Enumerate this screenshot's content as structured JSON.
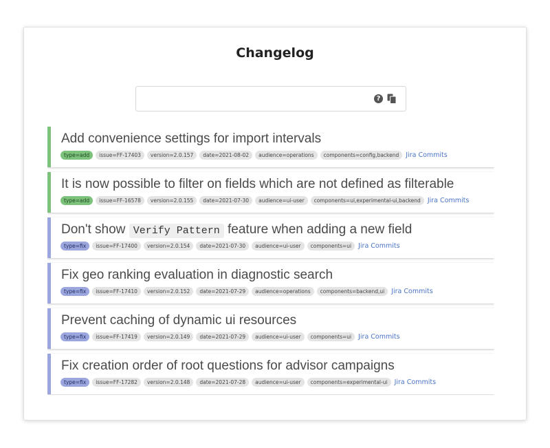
{
  "header": {
    "title": "Changelog"
  },
  "search": {
    "value": "",
    "placeholder": "",
    "help_icon": "question-circle-icon",
    "help_glyph": "?",
    "copy_icon": "copy-icon"
  },
  "colors": {
    "add": "#7cc17c",
    "fix": "#9aa6dd",
    "link": "#4a73c4"
  },
  "entries": [
    {
      "kind": "add",
      "title_pre": "Add convenience settings for import intervals",
      "title_code": "",
      "title_post": "",
      "tags": [
        "type=add",
        "issue=FF-17403",
        "version=2.0.157",
        "date=2021-08-02",
        "audience=operations",
        "components=config,backend"
      ],
      "link": "Jira Commits"
    },
    {
      "kind": "add",
      "title_pre": "It is now possible to filter on fields which are not defined as filterable",
      "title_code": "",
      "title_post": "",
      "tags": [
        "type=add",
        "issue=FF-16578",
        "version=2.0.155",
        "date=2021-07-30",
        "audience=ui-user",
        "components=ui,experimental-ui,backend"
      ],
      "link": "Jira Commits"
    },
    {
      "kind": "fix",
      "title_pre": "Don't show ",
      "title_code": "Verify Pattern",
      "title_post": " feature when adding a new field",
      "tags": [
        "type=fix",
        "issue=FF-17400",
        "version=2.0.154",
        "date=2021-07-30",
        "audience=ui-user",
        "components=ui"
      ],
      "link": "Jira Commits"
    },
    {
      "kind": "fix",
      "title_pre": "Fix geo ranking evaluation in diagnostic search",
      "title_code": "",
      "title_post": "",
      "tags": [
        "type=fix",
        "issue=FF-17410",
        "version=2.0.152",
        "date=2021-07-29",
        "audience=operations",
        "components=backend,ui"
      ],
      "link": "Jira Commits"
    },
    {
      "kind": "fix",
      "title_pre": "Prevent caching of dynamic ui resources",
      "title_code": "",
      "title_post": "",
      "tags": [
        "type=fix",
        "issue=FF-17419",
        "version=2.0.149",
        "date=2021-07-29",
        "audience=ui-user",
        "components=ui"
      ],
      "link": "Jira Commits"
    },
    {
      "kind": "fix",
      "title_pre": "Fix creation order of root questions for advisor campaigns",
      "title_code": "",
      "title_post": "",
      "tags": [
        "type=fix",
        "issue=FF-17282",
        "version=2.0.148",
        "date=2021-07-28",
        "audience=ui-user",
        "components=experimental-ui"
      ],
      "link": "Jira Commits"
    }
  ]
}
